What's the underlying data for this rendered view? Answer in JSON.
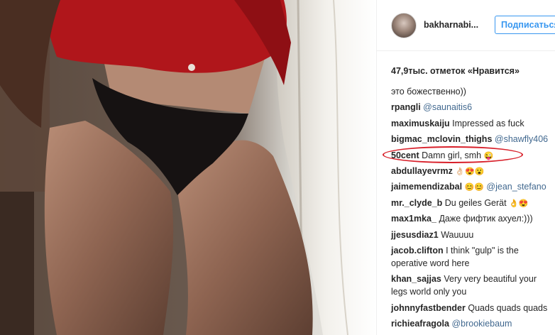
{
  "post": {
    "username": "bakharnabi...",
    "follow_label": "Подписаться",
    "likes_text": "47,9тыс. отметок «Нравится»"
  },
  "comments": [
    {
      "user": "",
      "text": "это божественно))",
      "mention": ""
    },
    {
      "user": "rpangli",
      "text": "",
      "mention": "@saunaitis6"
    },
    {
      "user": "maximuskaiju",
      "text": "Impressed as fuck",
      "mention": ""
    },
    {
      "user": "bigmac_mclovin_thighs",
      "text": "",
      "mention": "@shawfly406"
    },
    {
      "user": "50cent",
      "text": "Damn girl, smh",
      "emoji": "😜",
      "highlighted": true
    },
    {
      "user": "abdullayevrmz",
      "text": "",
      "emoji": "👌🏻😍😮"
    },
    {
      "user": "jaimemendizabal",
      "text": "",
      "emoji": "😊😊",
      "mention": "@jean_stefano"
    },
    {
      "user": "mr._clyde_b",
      "text": "Du geiles Gerät",
      "emoji": "👌😍"
    },
    {
      "user": "max1mka_",
      "text": "Даже фифтик ахуел:)))"
    },
    {
      "user": "jjesusdiaz1",
      "text": "Wauuuu"
    },
    {
      "user": "jacob.clifton",
      "text": "I think \"gulp\" is the operative word here"
    },
    {
      "user": "khan_sajjas",
      "text": "Very very beautiful your legs world only you"
    },
    {
      "user": "johnnyfastbender",
      "text": "Quads quads quads"
    },
    {
      "user": "richieafragola",
      "text": "",
      "mention": "@brookiebaum"
    }
  ],
  "colors": {
    "follow_blue": "#3897f0",
    "highlight_red": "#d8202a",
    "mention_blue": "#003569"
  },
  "icons": {
    "avatar": "profile-avatar"
  }
}
